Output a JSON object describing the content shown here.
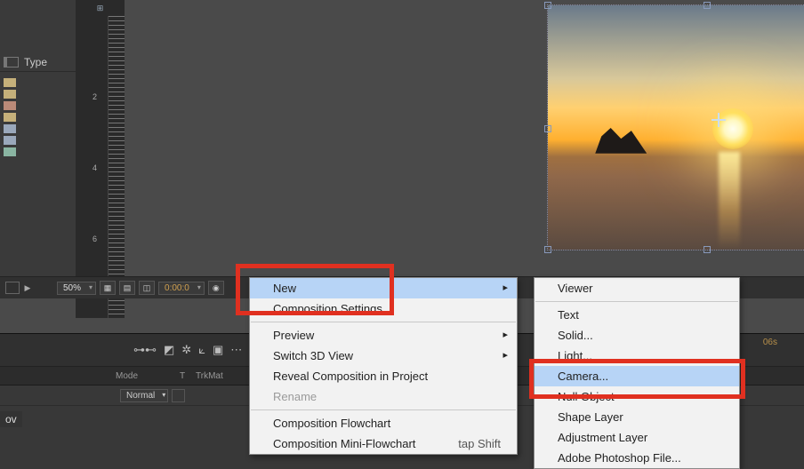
{
  "panel": {
    "type_label": "Type"
  },
  "ruler": {
    "marks": [
      "2",
      "4",
      "6"
    ]
  },
  "viewer_footer": {
    "zoom": "50%",
    "timecode": "0:00:0"
  },
  "timeline": {
    "cols": {
      "mode": "Mode",
      "t": "T",
      "trkmat": "TrkMat"
    },
    "row_mode": "Normal",
    "time_marks": [
      "06s"
    ],
    "clip_cut": "ov"
  },
  "context_menu": {
    "new": "New",
    "comp_settings": "Composition Settings...",
    "preview": "Preview",
    "switch_3d": "Switch 3D View",
    "reveal": "Reveal Composition in Project",
    "rename": "Rename",
    "flowchart": "Composition Flowchart",
    "mini_flow": "Composition Mini-Flowchart",
    "mini_flow_hint": "tap Shift"
  },
  "new_submenu": {
    "viewer": "Viewer",
    "text": "Text",
    "solid": "Solid...",
    "light": "Light...",
    "camera": "Camera...",
    "null_obj": "Null Object",
    "shape": "Shape Layer",
    "adjustment": "Adjustment Layer",
    "ps_file": "Adobe Photoshop File..."
  }
}
